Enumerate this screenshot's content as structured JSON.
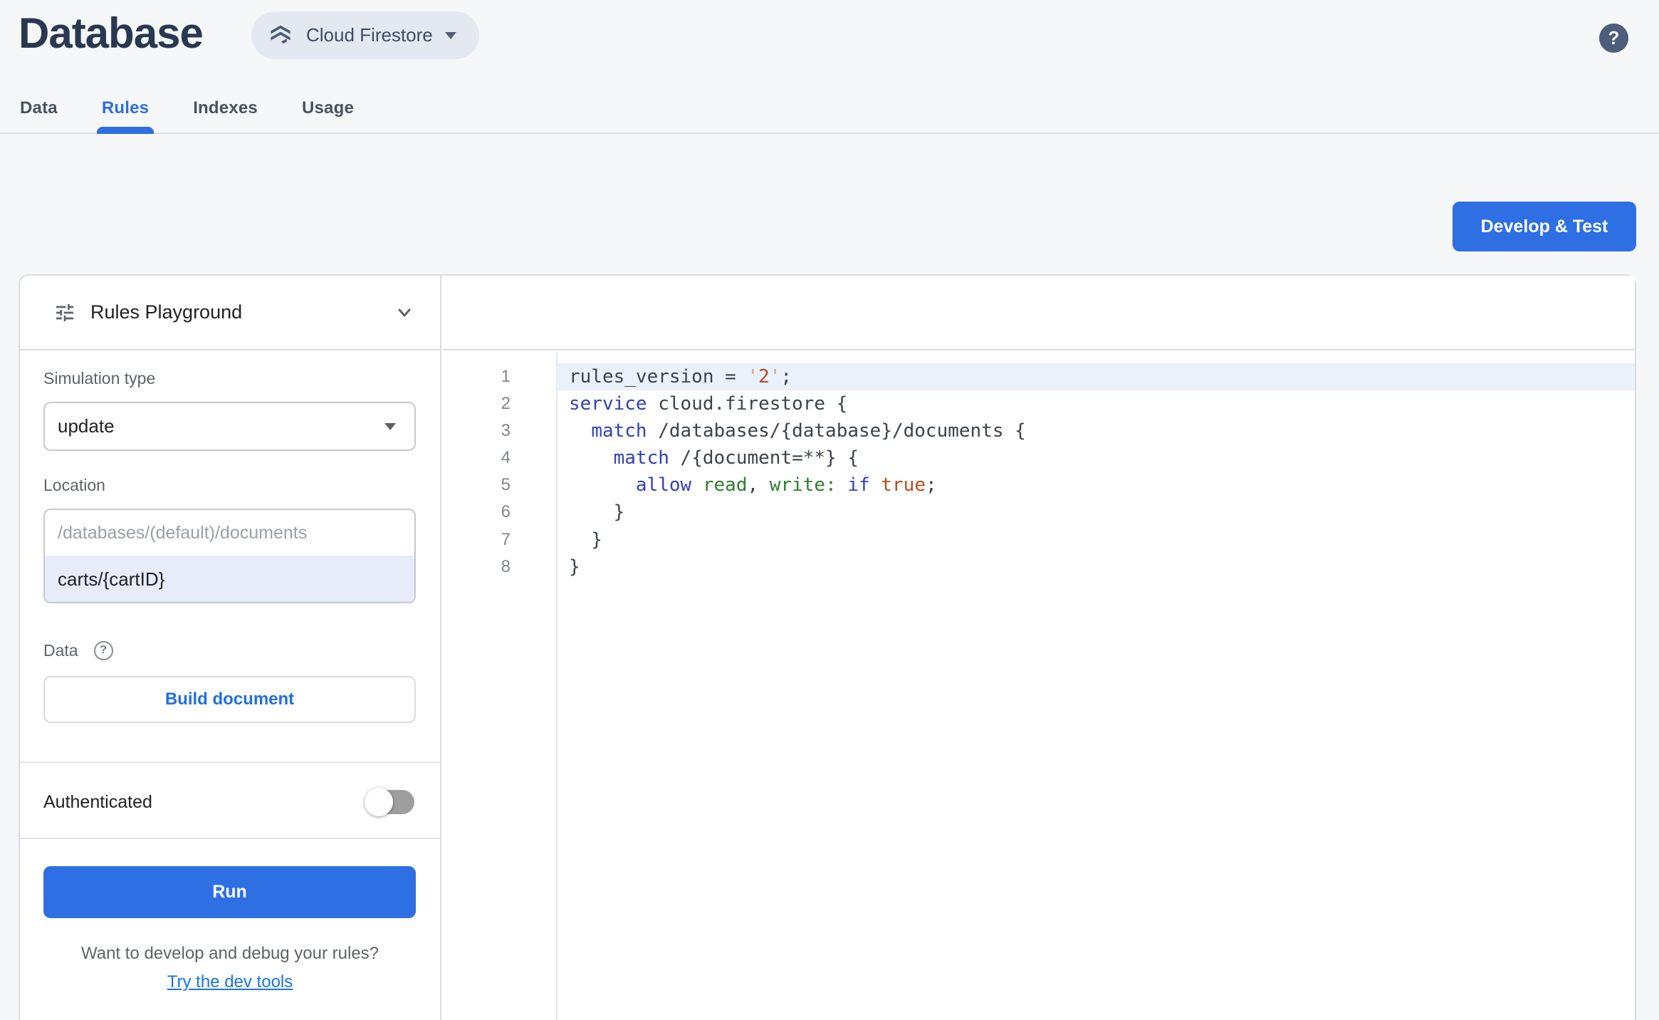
{
  "header": {
    "title": "Database",
    "product_selector": {
      "label": "Cloud Firestore"
    },
    "help_label": "?"
  },
  "tabs": [
    {
      "label": "Data",
      "active": false
    },
    {
      "label": "Rules",
      "active": true
    },
    {
      "label": "Indexes",
      "active": false
    },
    {
      "label": "Usage",
      "active": false
    }
  ],
  "actions": {
    "develop_test_label": "Develop & Test"
  },
  "playground": {
    "title": "Rules Playground",
    "simulation_type": {
      "label": "Simulation type",
      "value": "update"
    },
    "location": {
      "label": "Location",
      "placeholder": "/databases/(default)/documents",
      "value": "carts/{cartID}"
    },
    "data_section": {
      "label": "Data",
      "help_label": "?",
      "build_button_label": "Build document"
    },
    "authenticated": {
      "label": "Authenticated",
      "enabled": false
    },
    "run_button_label": "Run",
    "footer": {
      "question": "Want to develop and debug your rules?",
      "link_label": "Try the dev tools"
    }
  },
  "editor": {
    "lines": [
      {
        "num": "1",
        "highlighted": true,
        "tokens": [
          {
            "t": "rules_version = ",
            "c": "d"
          },
          {
            "t": "'",
            "c": "q"
          },
          {
            "t": "2",
            "c": "s"
          },
          {
            "t": "'",
            "c": "q"
          },
          {
            "t": ";",
            "c": "d"
          }
        ]
      },
      {
        "num": "2",
        "highlighted": false,
        "tokens": [
          {
            "t": "service",
            "c": "k"
          },
          {
            "t": " cloud.firestore {",
            "c": "d"
          }
        ]
      },
      {
        "num": "3",
        "highlighted": false,
        "tokens": [
          {
            "t": "  ",
            "c": "d"
          },
          {
            "t": "match",
            "c": "k"
          },
          {
            "t": " /databases/{database}/documents {",
            "c": "d"
          }
        ]
      },
      {
        "num": "4",
        "highlighted": false,
        "tokens": [
          {
            "t": "    ",
            "c": "d"
          },
          {
            "t": "match",
            "c": "k"
          },
          {
            "t": " /{document=**} {",
            "c": "d"
          }
        ]
      },
      {
        "num": "5",
        "highlighted": false,
        "tokens": [
          {
            "t": "      ",
            "c": "d"
          },
          {
            "t": "allow",
            "c": "k"
          },
          {
            "t": " ",
            "c": "d"
          },
          {
            "t": "read",
            "c": "g"
          },
          {
            "t": ", ",
            "c": "d"
          },
          {
            "t": "write",
            "c": "g"
          },
          {
            "t": ":",
            "c": "g"
          },
          {
            "t": " ",
            "c": "d"
          },
          {
            "t": "if",
            "c": "k"
          },
          {
            "t": " ",
            "c": "d"
          },
          {
            "t": "true",
            "c": "s"
          },
          {
            "t": ";",
            "c": "d"
          }
        ]
      },
      {
        "num": "6",
        "highlighted": false,
        "tokens": [
          {
            "t": "    }",
            "c": "d"
          }
        ]
      },
      {
        "num": "7",
        "highlighted": false,
        "tokens": [
          {
            "t": "  }",
            "c": "d"
          }
        ]
      },
      {
        "num": "8",
        "highlighted": false,
        "tokens": [
          {
            "t": "}",
            "c": "d"
          }
        ]
      }
    ]
  },
  "colors": {
    "accent_blue": "#2e6fe3",
    "link_blue": "#1a73e8",
    "title_navy": "#283850",
    "pill_background": "#e4e8f1",
    "code_keyword": "#3240b8",
    "code_string": "#c0491c",
    "code_string_quote": "#de9c86",
    "code_identifier_green": "#2e7d32",
    "code_default": "#3c434a",
    "code_line_highlight": "#e9f1fb",
    "location_selected_row": "#e8ecfa"
  }
}
